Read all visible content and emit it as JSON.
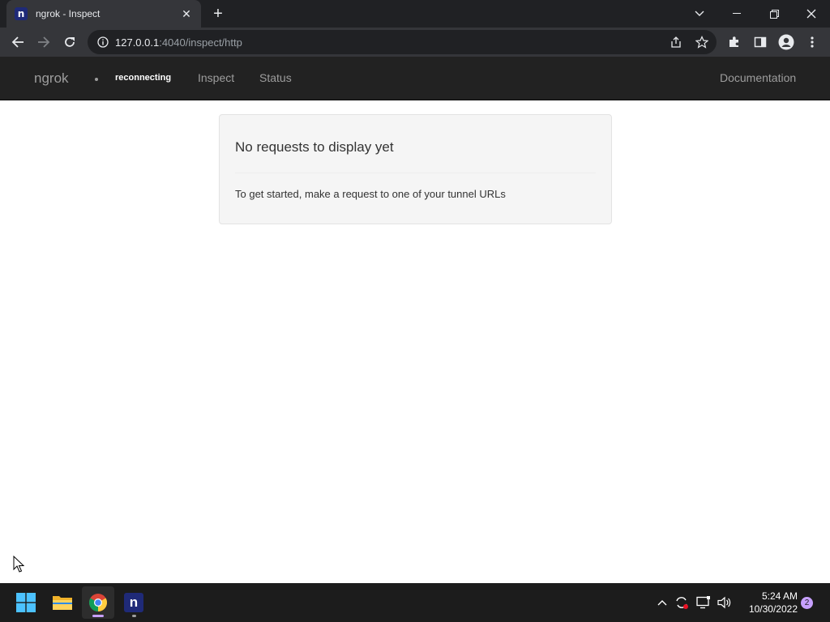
{
  "browser": {
    "tab_title": "ngrok - Inspect",
    "favicon_letter": "n",
    "url_host": "127.0.0.1",
    "url_rest": ":4040/inspect/http"
  },
  "navbar": {
    "brand": "ngrok",
    "status": "reconnecting",
    "links": [
      "Inspect",
      "Status"
    ],
    "documentation": "Documentation"
  },
  "content": {
    "heading": "No requests to display yet",
    "message": "To get started, make a request to one of your tunnel URLs"
  },
  "taskbar": {
    "time": "5:24 AM",
    "date": "10/30/2022",
    "notification_count": "2",
    "app_letter": "n"
  },
  "colors": {
    "navbar_bg": "#222222",
    "well_bg": "#f5f5f5",
    "chrome_dark": "#202124",
    "chrome_toolbar": "#35363a"
  }
}
